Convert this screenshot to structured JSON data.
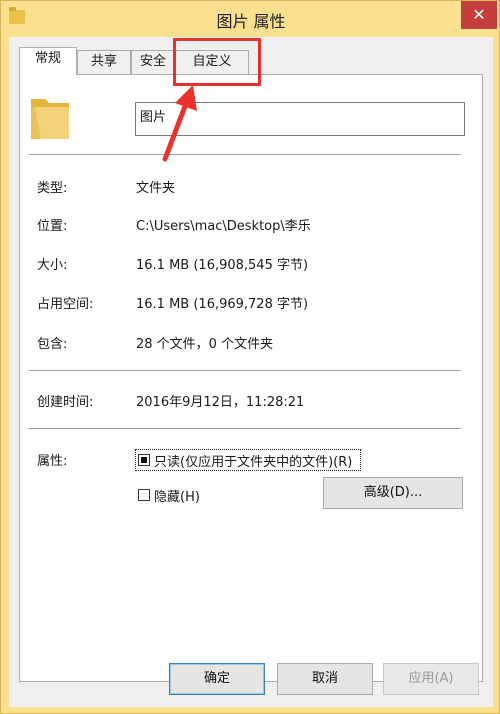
{
  "window": {
    "title": "图片 属性",
    "close_glyph": "✕"
  },
  "tabs": [
    {
      "label": "常规",
      "active": true
    },
    {
      "label": "共享",
      "active": false
    },
    {
      "label": "安全",
      "active": false
    },
    {
      "label": "自定义",
      "active": false
    }
  ],
  "general": {
    "folder_name": "图片",
    "rows": [
      {
        "label": "类型:",
        "value": "文件夹"
      },
      {
        "label": "位置:",
        "value": "C:\\Users\\mac\\Desktop\\李乐"
      },
      {
        "label": "大小:",
        "value": "16.1 MB (16,908,545 字节)"
      },
      {
        "label": "占用空间:",
        "value": "16.1 MB (16,969,728 字节)"
      },
      {
        "label": "包含:",
        "value": "28 个文件，0 个文件夹"
      },
      {
        "label": "创建时间:",
        "value": "2016年9月12日，11:28:21"
      }
    ],
    "attributes_label": "属性:",
    "readonly_label": "只读(仅应用于文件夹中的文件)(R)",
    "readonly_state": "partial",
    "hidden_label": "隐藏(H)",
    "hidden_checked": false,
    "advanced_button": "高级(D)..."
  },
  "footer": {
    "ok": "确定",
    "cancel": "取消",
    "apply": "应用(A)"
  },
  "annotation": {
    "color": "#e8322e"
  },
  "icons": {
    "title_folder": "folder-icon",
    "big_folder": "folder-icon"
  }
}
